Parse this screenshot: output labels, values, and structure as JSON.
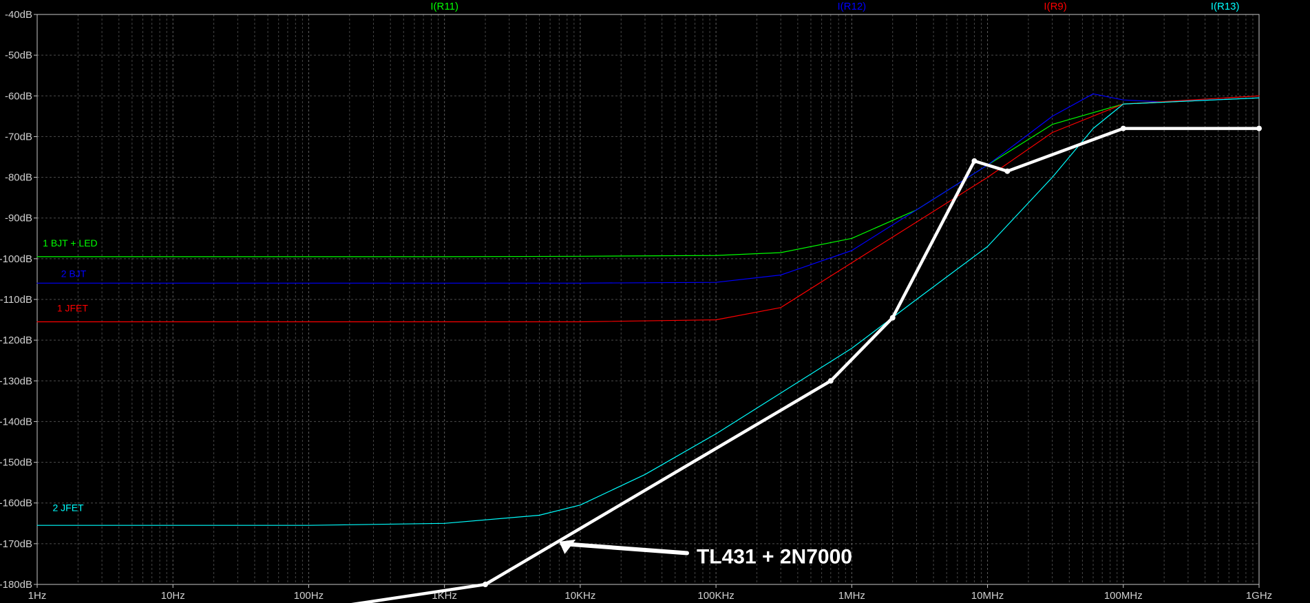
{
  "chart_data": {
    "type": "line",
    "x_scale": "log",
    "xlim": [
      1,
      1000000000
    ],
    "ylim": [
      -180,
      -40
    ],
    "x_tick_labels": [
      "1Hz",
      "10Hz",
      "100Hz",
      "1KHz",
      "10KHz",
      "100KHz",
      "1MHz",
      "10MHz",
      "100MHz",
      "1GHz"
    ],
    "y_tick_labels": [
      "-40dB",
      "-50dB",
      "-60dB",
      "-70dB",
      "-80dB",
      "-90dB",
      "-100dB",
      "-110dB",
      "-120dB",
      "-130dB",
      "-140dB",
      "-150dB",
      "-160dB",
      "-170dB",
      "-180dB"
    ],
    "grid": true,
    "background": "#000000",
    "header_traces": [
      {
        "label": "I(R11)",
        "color": "#00ff00",
        "freq": 1000
      },
      {
        "label": "I(R12)",
        "color": "#0000ff",
        "freq": 1000000
      },
      {
        "label": "I(R9)",
        "color": "#ff0000",
        "freq": 31600000
      },
      {
        "label": "I(R13)",
        "color": "#00ffff",
        "freq": 562000000
      }
    ],
    "series": [
      {
        "name": "1 BJT + LED",
        "color": "#00ff00",
        "label_freq": 1.1,
        "label_db": -97,
        "x": [
          1,
          100,
          1000,
          10000,
          100000,
          300000,
          1000000,
          3000000,
          10000000,
          30000000,
          100000000,
          1000000000
        ],
        "y": [
          -99.5,
          -99.5,
          -99.5,
          -99.4,
          -99.2,
          -98.5,
          -95,
          -88,
          -77,
          -67,
          -62,
          -60.5
        ]
      },
      {
        "name": "2 BJT",
        "color": "#0000ff",
        "label_freq": 1.5,
        "label_db": -104.5,
        "x": [
          1,
          100,
          1000,
          10000,
          100000,
          300000,
          1000000,
          3000000,
          10000000,
          30000000,
          60000000,
          100000000,
          200000000,
          1000000000
        ],
        "y": [
          -106,
          -106,
          -106,
          -106,
          -105.8,
          -104,
          -98,
          -88,
          -77,
          -65,
          -59.5,
          -61,
          -61.5,
          -60.5
        ]
      },
      {
        "name": "1 JFET",
        "color": "#ff0000",
        "label_freq": 1.4,
        "label_db": -113,
        "x": [
          1,
          100,
          1000,
          10000,
          100000,
          300000,
          1000000,
          3000000,
          10000000,
          30000000,
          100000000,
          1000000000
        ],
        "y": [
          -115.5,
          -115.5,
          -115.5,
          -115.5,
          -115,
          -112,
          -101,
          -91,
          -80,
          -69,
          -62,
          -60
        ]
      },
      {
        "name": "2 JFET",
        "color": "#00ffff",
        "label_freq": 1.3,
        "label_db": -162,
        "x": [
          1,
          100,
          1000,
          5000,
          10000,
          30000,
          100000,
          300000,
          1000000,
          3000000,
          10000000,
          30000000,
          60000000,
          100000000,
          1000000000
        ],
        "y": [
          -165.5,
          -165.5,
          -165,
          -163,
          -160.5,
          -153,
          -143,
          -133,
          -122,
          -110,
          -97,
          -80,
          -68,
          -62,
          -60.5
        ]
      },
      {
        "name": "TL431 + 2N7000",
        "color": "#ffffff",
        "bold": true,
        "annotation": true,
        "x": [
          200,
          2000,
          700000,
          2000000,
          8000000,
          14000000,
          100000000,
          1000000000
        ],
        "y": [
          -185,
          -180,
          -130,
          -114.5,
          -76,
          -78.5,
          -68,
          -68
        ]
      }
    ],
    "annotation": {
      "text": "TL431 + 2N7000",
      "arrow_tip_freq": 7000,
      "arrow_tip_db": -169.5,
      "text_freq": 72000,
      "text_db": -174.5
    }
  }
}
